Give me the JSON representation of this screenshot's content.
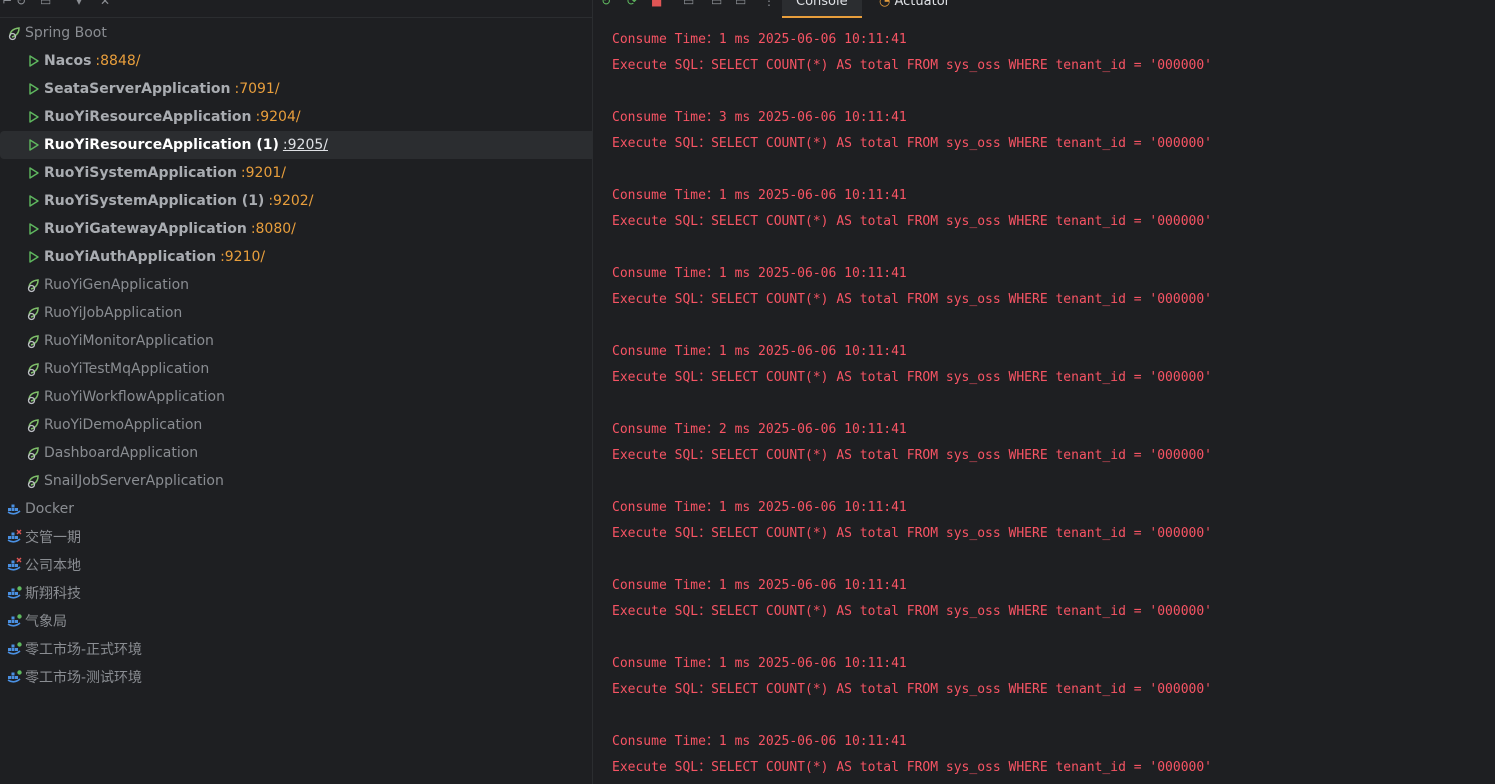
{
  "services": {
    "spring_boot_label": "Spring Boot",
    "apps": [
      {
        "name": "Nacos",
        "port": ":8848/",
        "running": true
      },
      {
        "name": "SeataServerApplication",
        "port": ":7091/",
        "running": true
      },
      {
        "name": "RuoYiResourceApplication",
        "port": ":9204/",
        "running": true
      },
      {
        "name": "RuoYiResourceApplication (1)",
        "port": ":9205/",
        "running": true
      },
      {
        "name": "RuoYiSystemApplication",
        "port": ":9201/",
        "running": true
      },
      {
        "name": "RuoYiSystemApplication (1)",
        "port": ":9202/",
        "running": true
      },
      {
        "name": "RuoYiGatewayApplication",
        "port": ":8080/",
        "running": true
      },
      {
        "name": "RuoYiAuthApplication",
        "port": ":9210/",
        "running": true
      },
      {
        "name": "RuoYiGenApplication",
        "port": "",
        "running": false
      },
      {
        "name": "RuoYiJobApplication",
        "port": "",
        "running": false
      },
      {
        "name": "RuoYiMonitorApplication",
        "port": "",
        "running": false
      },
      {
        "name": "RuoYiTestMqApplication",
        "port": "",
        "running": false
      },
      {
        "name": "RuoYiWorkflowApplication",
        "port": "",
        "running": false
      },
      {
        "name": "RuoYiDemoApplication",
        "port": "",
        "running": false
      },
      {
        "name": "DashboardApplication",
        "port": "",
        "running": false
      },
      {
        "name": "SnailJobServerApplication",
        "port": "",
        "running": false
      }
    ],
    "docker_label": "Docker",
    "docker_items": [
      {
        "name": "交管一期",
        "status": "error"
      },
      {
        "name": "公司本地",
        "status": "error"
      },
      {
        "name": "斯翔科技",
        "status": "ok"
      },
      {
        "name": "气象局",
        "status": "ok"
      },
      {
        "name": "零工市场-正式环境",
        "status": "ok"
      },
      {
        "name": "零工市场-测试环境",
        "status": "ok"
      }
    ]
  },
  "tabs": {
    "console": "Console",
    "actuator": "Actuator"
  },
  "console_log": [
    {
      "time": "Consume Time：1 ms 2025-06-06 10:11:41",
      "sql": "Execute SQL：SELECT COUNT(*) AS total FROM sys_oss WHERE tenant_id = '000000'"
    },
    {
      "time": "Consume Time：3 ms 2025-06-06 10:11:41",
      "sql": "Execute SQL：SELECT COUNT(*) AS total FROM sys_oss WHERE tenant_id = '000000'"
    },
    {
      "time": "Consume Time：1 ms 2025-06-06 10:11:41",
      "sql": "Execute SQL：SELECT COUNT(*) AS total FROM sys_oss WHERE tenant_id = '000000'"
    },
    {
      "time": "Consume Time：1 ms 2025-06-06 10:11:41",
      "sql": "Execute SQL：SELECT COUNT(*) AS total FROM sys_oss WHERE tenant_id = '000000'"
    },
    {
      "time": "Consume Time：1 ms 2025-06-06 10:11:41",
      "sql": "Execute SQL：SELECT COUNT(*) AS total FROM sys_oss WHERE tenant_id = '000000'"
    },
    {
      "time": "Consume Time：2 ms 2025-06-06 10:11:41",
      "sql": "Execute SQL：SELECT COUNT(*) AS total FROM sys_oss WHERE tenant_id = '000000'"
    },
    {
      "time": "Consume Time：1 ms 2025-06-06 10:11:41",
      "sql": "Execute SQL：SELECT COUNT(*) AS total FROM sys_oss WHERE tenant_id = '000000'"
    },
    {
      "time": "Consume Time：1 ms 2025-06-06 10:11:41",
      "sql": "Execute SQL：SELECT COUNT(*) AS total FROM sys_oss WHERE tenant_id = '000000'"
    },
    {
      "time": "Consume Time：1 ms 2025-06-06 10:11:41",
      "sql": "Execute SQL：SELECT COUNT(*) AS total FROM sys_oss WHERE tenant_id = '000000'"
    },
    {
      "time": "Consume Time：1 ms 2025-06-06 10:11:41",
      "sql": "Execute SQL：SELECT COUNT(*) AS total FROM sys_oss WHERE tenant_id = '000000'"
    }
  ],
  "colors": {
    "background": "#1e1f22",
    "selection": "#2b2d30",
    "port": "#e89e3c",
    "run_icon": "#5fb85f",
    "log_text": "#f75464",
    "docker_icon": "#4a90e2",
    "error_badge": "#e05555"
  }
}
